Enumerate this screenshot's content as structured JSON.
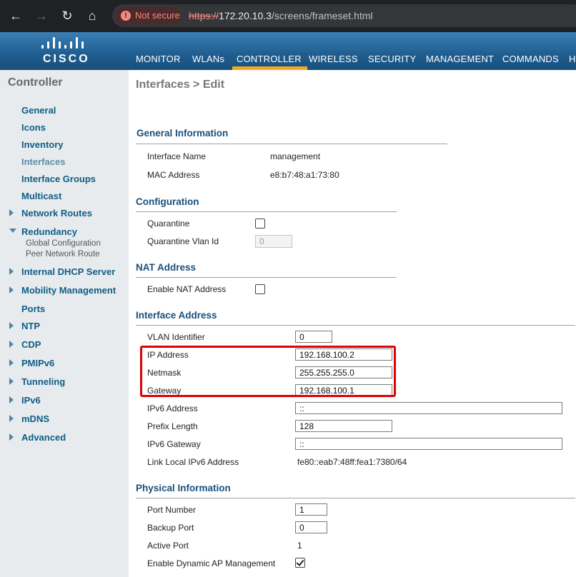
{
  "browser": {
    "security_label": "Not secure",
    "url_scheme": "https://",
    "url_host": "172.20.10.3",
    "url_path": "/screens/frameset.html"
  },
  "brand": {
    "logo_text": "CISCO"
  },
  "menu": [
    {
      "label": "MONITOR"
    },
    {
      "label": "WLANs"
    },
    {
      "label": "CONTROLLER",
      "active": true
    },
    {
      "label": "WIRELESS"
    },
    {
      "label": "SECURITY"
    },
    {
      "label": "MANAGEMENT"
    },
    {
      "label": "COMMANDS"
    },
    {
      "label": "HE"
    }
  ],
  "sidebar": {
    "title": "Controller",
    "items": [
      {
        "label": "General"
      },
      {
        "label": "Icons"
      },
      {
        "label": "Inventory"
      },
      {
        "label": "Interfaces",
        "current": true
      },
      {
        "label": "Interface Groups"
      },
      {
        "label": "Multicast"
      },
      {
        "label": "Network Routes",
        "expander": "collapsed"
      },
      {
        "label": "Redundancy",
        "expander": "expanded"
      },
      {
        "label": "Internal DHCP Server",
        "expander": "collapsed"
      },
      {
        "label": "Mobility Management",
        "expander": "collapsed"
      },
      {
        "label": "Ports"
      },
      {
        "label": "NTP",
        "expander": "collapsed"
      },
      {
        "label": "CDP",
        "expander": "collapsed"
      },
      {
        "label": "PMIPv6",
        "expander": "collapsed"
      },
      {
        "label": "Tunneling",
        "expander": "collapsed"
      },
      {
        "label": "IPv6",
        "expander": "collapsed"
      },
      {
        "label": "mDNS",
        "expander": "collapsed"
      },
      {
        "label": "Advanced",
        "expander": "collapsed"
      }
    ],
    "redundancy_sub": [
      "Global Configuration",
      "Peer Network Route"
    ]
  },
  "page": {
    "title": "Interfaces > Edit"
  },
  "general": {
    "title": "General Information",
    "interface_name_label": "Interface Name",
    "interface_name": "management",
    "mac_label": "MAC Address",
    "mac": "e8:b7:48:a1:73:80"
  },
  "configuration": {
    "title": "Configuration",
    "quarantine_label": "Quarantine",
    "quarantine_checked": false,
    "quarantine_vlan_label": "Quarantine Vlan Id",
    "quarantine_vlan": "0"
  },
  "nat": {
    "title": "NAT Address",
    "enable_label": "Enable NAT Address",
    "enable_checked": false
  },
  "interface_address": {
    "title": "Interface Address",
    "vlan_label": "VLAN Identifier",
    "vlan": "0",
    "ip_label": "IP Address",
    "ip": "192.168.100.2",
    "netmask_label": "Netmask",
    "netmask": "255.255.255.0",
    "gateway_label": "Gateway",
    "gateway": "192.168.100.1",
    "ipv6_label": "IPv6 Address",
    "ipv6": "::",
    "prefix_label": "Prefix Length",
    "prefix": "128",
    "ipv6_gw_label": "IPv6 Gateway",
    "ipv6_gw": "::",
    "link_local_label": "Link Local IPv6 Address",
    "link_local": "fe80::eab7:48ff:fea1:7380/64"
  },
  "physical": {
    "title": "Physical Information",
    "port_label": "Port Number",
    "port": "1",
    "backup_label": "Backup Port",
    "backup": "0",
    "active_label": "Active Port",
    "active": "1",
    "dynamic_ap_label": "Enable Dynamic AP Management",
    "dynamic_ap_checked": true
  },
  "colors": {
    "header": "#1f5d8f",
    "menu_active": "#f5a623",
    "sidebar_bg": "#e8ebed",
    "link": "#0e5d86",
    "highlight": "#e00000"
  }
}
